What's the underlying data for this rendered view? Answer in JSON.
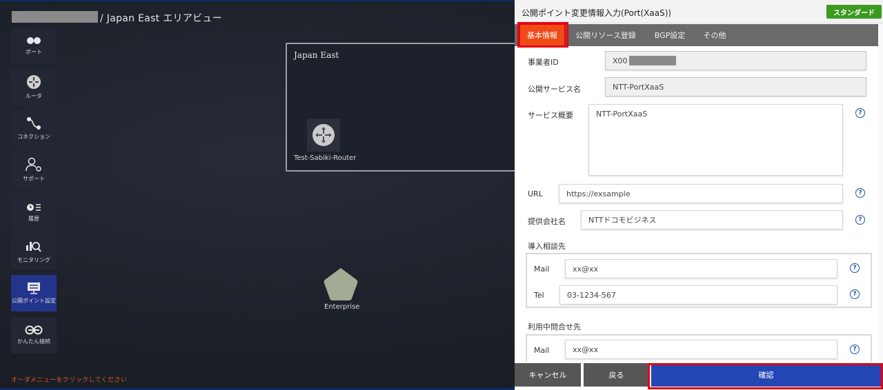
{
  "breadcrumb": {
    "area": "/ Japan East エリアビュー"
  },
  "sidebar": {
    "items": [
      {
        "label": "ポート",
        "icon": "port-icon"
      },
      {
        "label": "ルータ",
        "icon": "router-icon"
      },
      {
        "label": "コネクション",
        "icon": "connection-icon"
      },
      {
        "label": "サポート",
        "icon": "support-icon"
      },
      {
        "label": "履歴",
        "icon": "history-icon"
      },
      {
        "label": "モニタリング",
        "icon": "monitoring-icon"
      },
      {
        "label": "公開ポイント設定",
        "icon": "public-point-icon"
      },
      {
        "label": "かんたん接続",
        "icon": "easy-connect-icon"
      }
    ],
    "order_message": "オーダメニューをクリックしてください"
  },
  "canvas": {
    "area_title": "Japan East",
    "router_label": "Test-Sabiki-Router",
    "enterprise_label": "Enterprise"
  },
  "panel": {
    "title": "公開ポイント変更情報入力(Port(XaaS))",
    "badge": "スタンダード",
    "tabs": [
      "基本情報",
      "公開リソース登録",
      "BGP設定",
      "その他"
    ],
    "fields": {
      "operator_id": {
        "label": "事業者ID",
        "value": "X00"
      },
      "service_name": {
        "label": "公開サービス名",
        "value": "NTT-PortXaaS"
      },
      "service_summary": {
        "label": "サービス概要",
        "value": "NTT-PortXaaS"
      },
      "url": {
        "label": "URL",
        "value": "https://exsample"
      },
      "provider": {
        "label": "提供会社名",
        "value": "NTTドコモビジネス"
      }
    },
    "intro_contact": {
      "label": "導入相談先",
      "mail_label": "Mail",
      "mail_value": "xx@xx",
      "tel_label": "Tel",
      "tel_value": "03-1234-567"
    },
    "usage_contact": {
      "label": "利用中問合せ先",
      "mail_label": "Mail",
      "mail_value": "xx@xx"
    },
    "help_glyph": "?"
  },
  "footer": {
    "cancel": "キャンセル",
    "back": "戻る",
    "confirm": "確認"
  },
  "colors": {
    "accent_red": "#e60012",
    "active_tab": "#ee4b16",
    "confirm_blue": "#2446b5",
    "badge_green": "#3c9a1f"
  }
}
